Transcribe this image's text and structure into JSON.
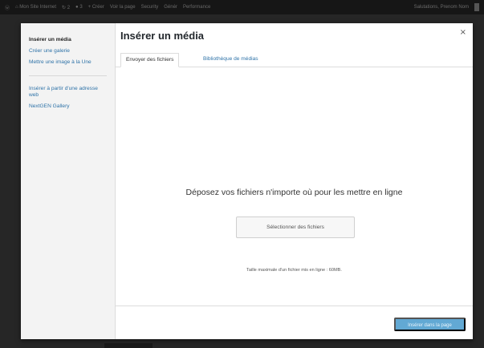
{
  "adminbar": {
    "items": [
      "ⓦ",
      "⌂ Mon Site Internet",
      "↻ 2",
      "● 3",
      "+ Créer",
      "Voir la page",
      "Security",
      "Génér",
      "Performance"
    ],
    "user": "Salutations, Prenom Nom"
  },
  "menu": {
    "items": [
      {
        "label": "Insérer un média",
        "active": true
      },
      {
        "label": "Créer une galerie",
        "active": false
      },
      {
        "label": "Mettre une image à la Une",
        "active": false
      }
    ],
    "items2": [
      {
        "label": "Insérer à partir d'une adresse web",
        "active": false
      },
      {
        "label": "NextGEN Gallery",
        "active": false
      }
    ]
  },
  "frame": {
    "title": "Insérer un média",
    "close": "×"
  },
  "tabs": {
    "upload": "Envoyer des fichiers",
    "library": "Bibliothèque de médias"
  },
  "dropzone": {
    "instructions": "Déposez vos fichiers n'importe où pour les mettre en ligne",
    "select_button": "Sélectionner des fichiers",
    "max_size": "Taille maximale d'un fichier mis en ligne : 60MB."
  },
  "toolbar": {
    "insert_button": "Insérer dans la page"
  },
  "colors": {
    "link": "#2f73a8",
    "primary_button": "#62a9d4"
  }
}
